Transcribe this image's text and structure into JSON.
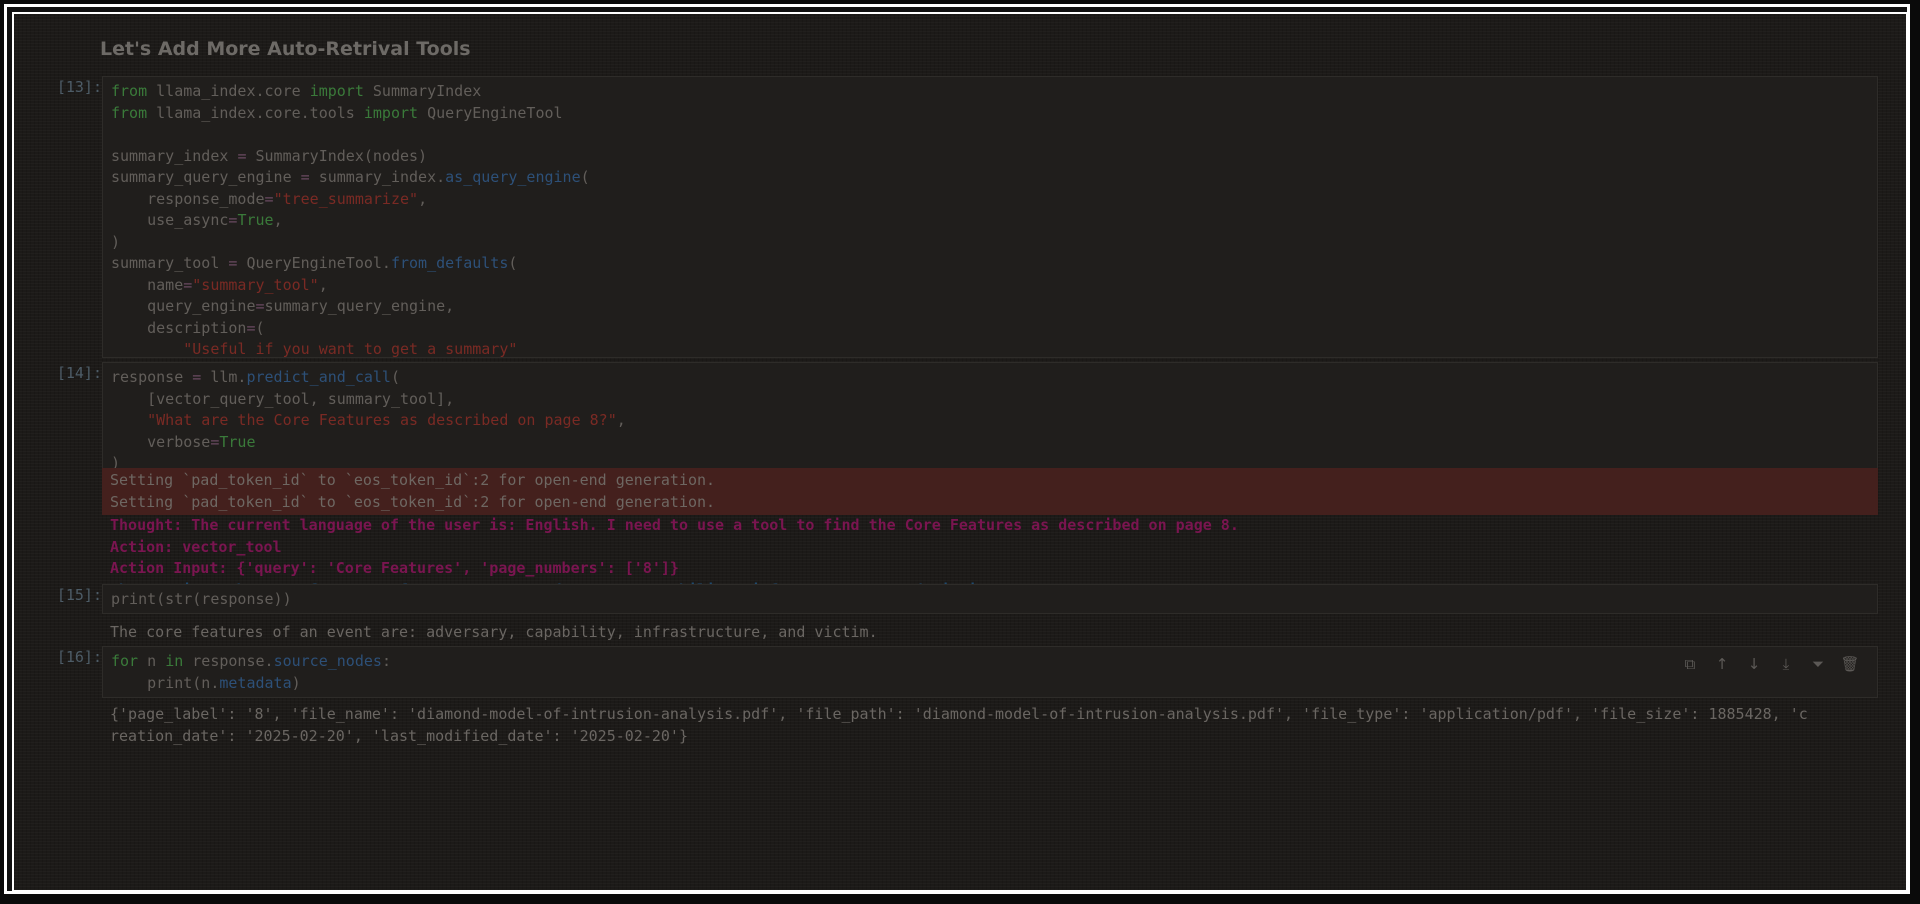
{
  "heading": "Let's Add More Auto-Retrival Tools",
  "cells": {
    "c13": {
      "prompt": "[13]:",
      "lines": [
        [
          {
            "t": "from",
            "c": "kw"
          },
          {
            "t": " llama_index.core "
          },
          {
            "t": "import",
            "c": "kw"
          },
          {
            "t": " SummaryIndex"
          }
        ],
        [
          {
            "t": "from",
            "c": "kw"
          },
          {
            "t": " llama_index.core.tools "
          },
          {
            "t": "import",
            "c": "kw"
          },
          {
            "t": " QueryEngineTool"
          }
        ],
        [],
        [
          {
            "t": "summary_index "
          },
          {
            "t": "=",
            "c": "op"
          },
          {
            "t": " SummaryIndex(nodes)"
          }
        ],
        [
          {
            "t": "summary_query_engine "
          },
          {
            "t": "=",
            "c": "op"
          },
          {
            "t": " summary_index."
          },
          {
            "t": "as_query_engine",
            "c": "fn"
          },
          {
            "t": "("
          }
        ],
        [
          {
            "t": "    response_mode"
          },
          {
            "t": "=",
            "c": "op"
          },
          {
            "t": "\"tree_summarize\"",
            "c": "str"
          },
          {
            "t": ","
          }
        ],
        [
          {
            "t": "    use_async"
          },
          {
            "t": "=",
            "c": "op"
          },
          {
            "t": "True",
            "c": "kw"
          },
          {
            "t": ","
          }
        ],
        [
          {
            "t": ")"
          }
        ],
        [
          {
            "t": "summary_tool "
          },
          {
            "t": "=",
            "c": "op"
          },
          {
            "t": " QueryEngineTool."
          },
          {
            "t": "from_defaults",
            "c": "fn"
          },
          {
            "t": "("
          }
        ],
        [
          {
            "t": "    name"
          },
          {
            "t": "=",
            "c": "op"
          },
          {
            "t": "\"summary_tool\"",
            "c": "str"
          },
          {
            "t": ","
          }
        ],
        [
          {
            "t": "    query_engine"
          },
          {
            "t": "=",
            "c": "op"
          },
          {
            "t": "summary_query_engine,"
          }
        ],
        [
          {
            "t": "    description"
          },
          {
            "t": "=",
            "c": "op"
          },
          {
            "t": "("
          }
        ],
        [
          {
            "t": "        "
          },
          {
            "t": "\"Useful if you want to get a summary\"",
            "c": "str"
          }
        ],
        [
          {
            "t": "    ),"
          }
        ],
        [
          {
            "t": ")"
          }
        ]
      ]
    },
    "c14": {
      "prompt": "[14]:",
      "lines": [
        [
          {
            "t": "response "
          },
          {
            "t": "=",
            "c": "op"
          },
          {
            "t": " llm."
          },
          {
            "t": "predict_and_call",
            "c": "fn"
          },
          {
            "t": "("
          }
        ],
        [
          {
            "t": "    [vector_query_tool, summary_tool],"
          }
        ],
        [
          {
            "t": "    "
          },
          {
            "t": "\"What are the Core Features as described on page 8?\"",
            "c": "str"
          },
          {
            "t": ","
          }
        ],
        [
          {
            "t": "    verbose"
          },
          {
            "t": "=",
            "c": "op"
          },
          {
            "t": "True",
            "c": "kw"
          }
        ],
        [
          {
            "t": ")"
          }
        ]
      ],
      "stderr": [
        "Setting `pad_token_id` to `eos_token_id`:2 for open-end generation.",
        "Setting `pad_token_id` to `eos_token_id`:2 for open-end generation."
      ],
      "stdout_thought": "Thought: The current language of the user is: English. I need to use a tool to find the Core Features as described on page 8.",
      "stdout_action": "Action: vector_tool",
      "stdout_action_input": "Action Input: {'query': 'Core Features', 'page_numbers': ['8']}",
      "stdout_observation": "Observation: The core features of an event are: adversary, capability, infrastructure, and victim."
    },
    "c15": {
      "prompt": "[15]:",
      "lines": [
        [
          {
            "t": "print(str(response))"
          }
        ]
      ],
      "output": "The core features of an event are: adversary, capability, infrastructure, and victim."
    },
    "c16": {
      "prompt": "[16]:",
      "lines": [
        [
          {
            "t": "for",
            "c": "kw"
          },
          {
            "t": " n "
          },
          {
            "t": "in",
            "c": "kw"
          },
          {
            "t": " response."
          },
          {
            "t": "source_nodes",
            "c": "fn"
          },
          {
            "t": ":"
          }
        ],
        [
          {
            "t": "    print(n."
          },
          {
            "t": "metadata",
            "c": "fn"
          },
          {
            "t": ")"
          }
        ]
      ],
      "output_line1": "{'page_label': '8', 'file_name': 'diamond-model-of-intrusion-analysis.pdf', 'file_path': 'diamond-model-of-intrusion-analysis.pdf', 'file_type': 'application/pdf', 'file_size': 1885428, 'c",
      "output_line2": "reation_date': '2025-02-20', 'last_modified_date': '2025-02-20'}",
      "toolbar_icons": [
        "copy-icon",
        "arrow-up-icon",
        "arrow-down-icon",
        "insert-below-icon",
        "merge-icon",
        "trash-icon"
      ],
      "toolbar_glyphs": [
        "⧉",
        "↑",
        "↓",
        "⤓",
        "⏷",
        "🗑"
      ]
    }
  }
}
